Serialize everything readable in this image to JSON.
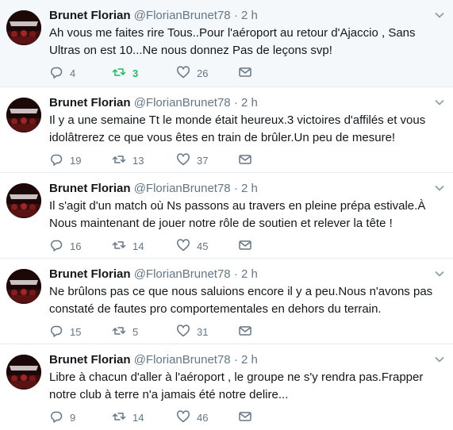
{
  "tweets": [
    {
      "name": "Brunet Florian",
      "handle": "@FlorianBrunet78",
      "dot": "·",
      "time": "2 h",
      "text": "Ah vous me faites rire Tous..Pour l'aéroport au retour d'Ajaccio , Sans Ultras on est 10...Ne nous donnez Pas de leçons svp!",
      "replies": "4",
      "retweets": "3",
      "likes": "26",
      "retweeted": true
    },
    {
      "name": "Brunet Florian",
      "handle": "@FlorianBrunet78",
      "dot": "·",
      "time": "2 h",
      "text": "Il y a une semaine Tt le monde était heureux.3 victoires d'affilés et vous idolâtrerez ce que vous êtes en train de brûler.Un peu de mesure!",
      "replies": "19",
      "retweets": "13",
      "likes": "37",
      "retweeted": false
    },
    {
      "name": "Brunet Florian",
      "handle": "@FlorianBrunet78",
      "dot": "·",
      "time": "2 h",
      "text": "Il s'agit d'un match où Ns passons au travers en pleine prépa estivale.À Nous maintenant de jouer notre rôle de soutien et relever la tête !",
      "replies": "16",
      "retweets": "14",
      "likes": "45",
      "retweeted": false
    },
    {
      "name": "Brunet Florian",
      "handle": "@FlorianBrunet78",
      "dot": "·",
      "time": "2 h",
      "text": "Ne brûlons pas ce que nous saluions encore il y a peu.Nous n'avons pas constaté de fautes pro comportementales en dehors du terrain.",
      "replies": "15",
      "retweets": "5",
      "likes": "31",
      "retweeted": false
    },
    {
      "name": "Brunet Florian",
      "handle": "@FlorianBrunet78",
      "dot": "·",
      "time": "2 h",
      "text": "Libre à chacun d'aller à l'aéroport , le groupe ne s'y rendra pas.Frapper notre club à terre n'a jamais été notre delire...",
      "replies": "9",
      "retweets": "14",
      "likes": "46",
      "retweeted": false
    }
  ],
  "icons": {
    "reply": "reply-icon",
    "retweet": "retweet-icon",
    "like": "heart-icon",
    "dm": "envelope-icon",
    "caret": "chevron-down-icon"
  },
  "colors": {
    "retweet_active": "#17bf63",
    "secondary_text": "#657786",
    "highlight_bg": "#f5f8fa"
  }
}
